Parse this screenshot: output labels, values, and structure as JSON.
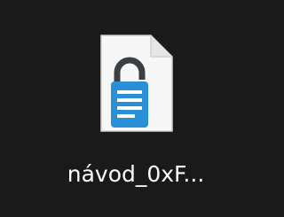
{
  "desktop": {
    "file": {
      "name": "návod_0xF...",
      "icon": "encrypted-document-icon",
      "accent_color": "#2b8fd8",
      "lock_color": "#3a3f46"
    }
  }
}
